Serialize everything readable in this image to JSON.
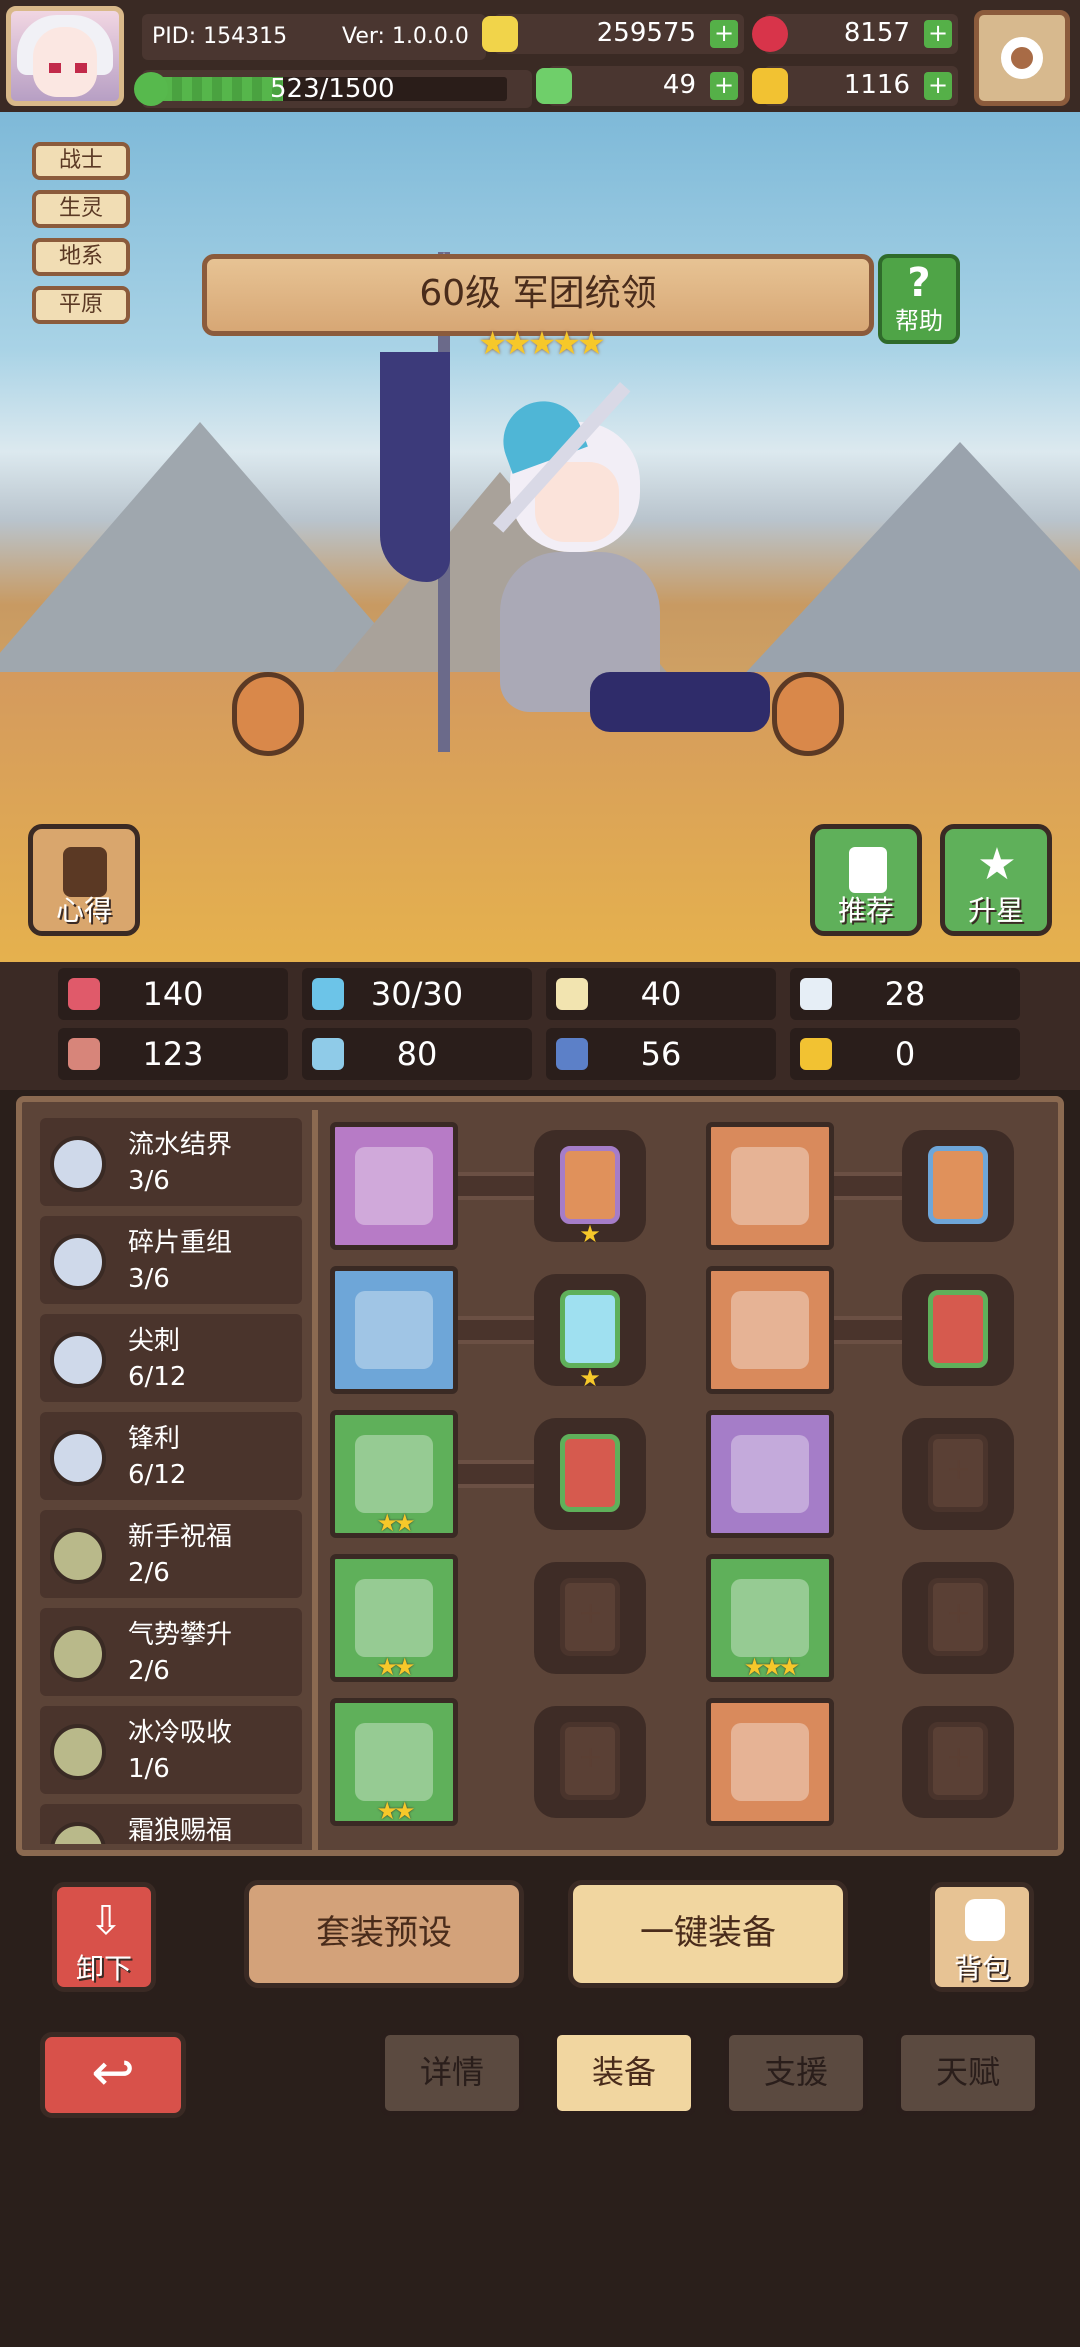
{
  "header": {
    "pid": "PID: 154315",
    "version": "Ver: 1.0.0.0",
    "xp": "523/1500",
    "xp_progress": 0.35,
    "coins": "259575",
    "gems": "8157",
    "clover": "49",
    "keys": "1116"
  },
  "hero": {
    "tags": [
      "战士",
      "生灵",
      "地系",
      "平原"
    ],
    "title": "60级 军团统领",
    "stars": "★★★★★",
    "help_label": "帮助",
    "tips_label": "心得",
    "recommend_label": "推荐",
    "star_up_label": "升星"
  },
  "stats": [
    {
      "icon": "heart-icon",
      "value": "140",
      "color": "#e05a6a"
    },
    {
      "icon": "water-drop-icon",
      "value": "30/30",
      "color": "#6cc4e8"
    },
    {
      "icon": "shield-icon",
      "value": "40",
      "color": "#f2e4b0"
    },
    {
      "icon": "wing-icon",
      "value": "28",
      "color": "#e6eef6"
    },
    {
      "icon": "fist-icon",
      "value": "123",
      "color": "#d7857a"
    },
    {
      "icon": "book-icon",
      "value": "80",
      "color": "#8fcbe8"
    },
    {
      "icon": "scroll-icon",
      "value": "56",
      "color": "#5c80c8"
    },
    {
      "icon": "horseshoe-icon",
      "value": "0",
      "color": "#f2c232"
    }
  ],
  "sets": [
    {
      "name": "流水结界",
      "count": "3/6",
      "color": "#cfd9ea"
    },
    {
      "name": "碎片重组",
      "count": "3/6",
      "color": "#cfd9ea"
    },
    {
      "name": "尖刺",
      "count": "6/12",
      "color": "#cfd9ea"
    },
    {
      "name": "锋利",
      "count": "6/12",
      "color": "#cfd9ea"
    },
    {
      "name": "新手祝福",
      "count": "2/6",
      "color": "#b9b98a"
    },
    {
      "name": "气势攀升",
      "count": "2/6",
      "color": "#b9b98a"
    },
    {
      "name": "冰冷吸收",
      "count": "1/6",
      "color": "#b9b98a"
    },
    {
      "name": "霜狼赐福",
      "count": "",
      "color": "#b9b98a"
    }
  ],
  "equipment_left": [
    {
      "name": "sword",
      "stars": "",
      "bg": "#b77bc6",
      "gem": {
        "color": "#e0915b",
        "frame": "#a57dc8",
        "stars": "★"
      }
    },
    {
      "name": "round-shield",
      "stars": "",
      "bg": "#6ea6d8",
      "gem": {
        "color": "#9fe0f0",
        "frame": "#5fb05a",
        "stars": "★"
      }
    },
    {
      "name": "necklace",
      "stars": "★★",
      "bg": "#5fb05a",
      "gem": {
        "color": "#d65a4e",
        "frame": "#5fb05a",
        "stars": ""
      }
    },
    {
      "name": "amulet",
      "stars": "★★",
      "bg": "#5fb05a",
      "gem": null
    },
    {
      "name": "ring",
      "stars": "★★",
      "bg": "#5fb05a",
      "gem": null
    }
  ],
  "equipment_right": [
    {
      "name": "crown",
      "stars": "",
      "bg": "#d98a5c",
      "gem": {
        "color": "#e0915b",
        "frame": "#6ea6d8",
        "stars": ""
      }
    },
    {
      "name": "armor",
      "stars": "",
      "bg": "#d98a5c",
      "gem": {
        "color": "#d65a4e",
        "frame": "#5fb05a",
        "stars": ""
      }
    },
    {
      "name": "bracer",
      "stars": "",
      "bg": "#a57dc8",
      "gem": null
    },
    {
      "name": "belt",
      "stars": "★★★",
      "bg": "#5fb05a",
      "gem": null
    },
    {
      "name": "boots",
      "stars": "",
      "bg": "#d98a5c",
      "gem": null
    }
  ],
  "actions": {
    "unequip": "卸下",
    "preset": "套装预设",
    "auto_equip": "一键装备",
    "bag": "背包"
  },
  "tabs": [
    "详情",
    "装备",
    "支援",
    "天赋"
  ]
}
